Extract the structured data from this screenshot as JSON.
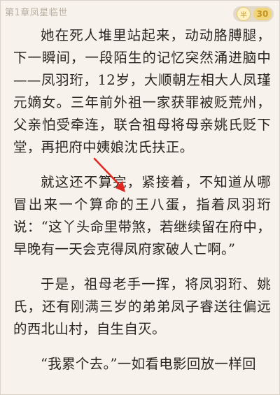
{
  "header": {
    "chapter_title": "第1章凤星临世",
    "coin_icon_label": "半",
    "coin_count": "30"
  },
  "paragraphs": [
    "她在死人堆里站起来，动动胳膊腿，下一瞬间，一段陌生的记忆突然涌进脑中——凤羽珩，12岁，大顺朝左相大人凤瑾元嫡女。三年前外祖一家获罪被贬荒州，父亲怕受牵连，联合祖母将母亲姚氏贬下堂，再把府中姨娘沈氏扶正。",
    "就这还不算完，紧接着，不知道从哪冒出来一个算命的王八蛋，指着凤羽珩说：“这丫头命里带煞，若继续留在府中，早晚有一天会克得凤府家破人亡啊。”",
    "于是，祖母老手一挥，将凤羽珩、姚氏，还有刚满三岁的弟弟凤子睿送往偏远的西北山村，自生自灭。",
    "“我累个去。”一如看电影回放一样回"
  ],
  "colors": {
    "page_bg": "#f7f3ec",
    "text": "#2b2520",
    "chapter_title": "#b7ada0",
    "coin_badge_bg": "#e2d9c9",
    "coin_count_bg": "#f1d57a",
    "coin_count_text": "#c29422",
    "arrow": "#e0261e"
  },
  "icons": {
    "coin": "coin-icon",
    "annotation": "red-arrow-icon"
  }
}
